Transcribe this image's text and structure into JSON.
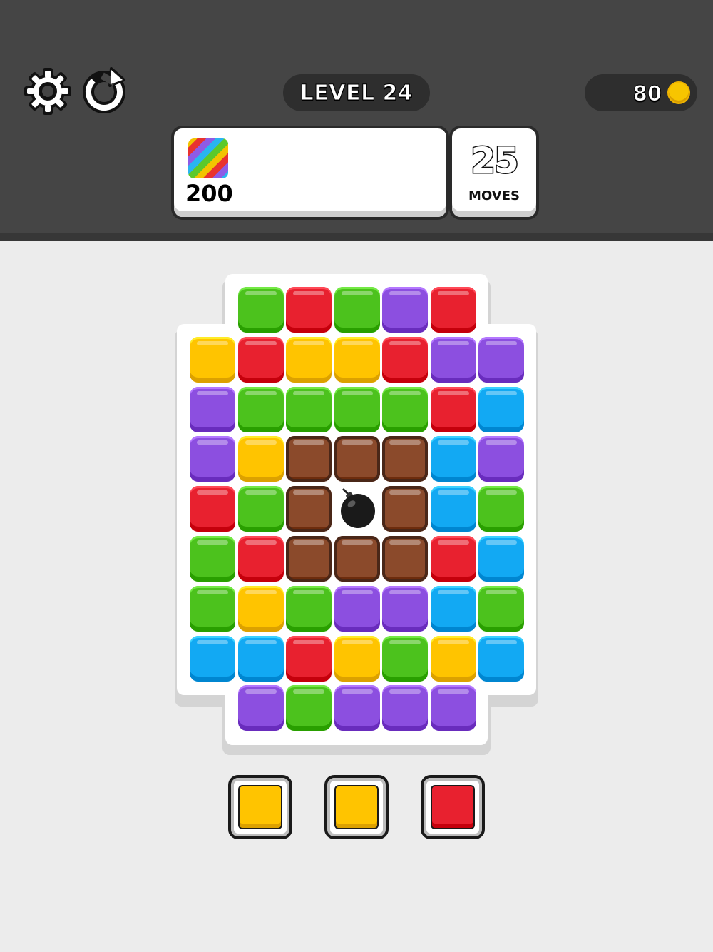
{
  "header": {
    "level_text": "LEVEL 24",
    "coins": "80",
    "settings_icon": "gear-icon",
    "restart_icon": "restart-icon"
  },
  "goal": {
    "icon": "rainbow-block-icon",
    "count": "200"
  },
  "moves": {
    "count": "25",
    "label": "MOVES"
  },
  "colors": {
    "G": "#4cc21d",
    "R": "#e8212f",
    "P": "#8c4fe0",
    "Y": "#ffc400",
    "B": "#12a9f3",
    "C": "#8b4a2b"
  },
  "board": {
    "rows": [
      "_GRGPR_",
      "YRYYRPP",
      "PGGGGRB",
      "PYCCCBP",
      "RGCXCBG",
      "GRCCCRB",
      "GYGPPBG",
      "BBRYGYB",
      "_PGPPP_"
    ],
    "legend": {
      "G": "green",
      "R": "red",
      "P": "purple",
      "Y": "yellow",
      "B": "blue",
      "C": "chocolate",
      "X": "bomb",
      "_": "empty"
    }
  },
  "tray": [
    {
      "color": "yellow"
    },
    {
      "color": "yellow"
    },
    {
      "color": "red"
    }
  ]
}
